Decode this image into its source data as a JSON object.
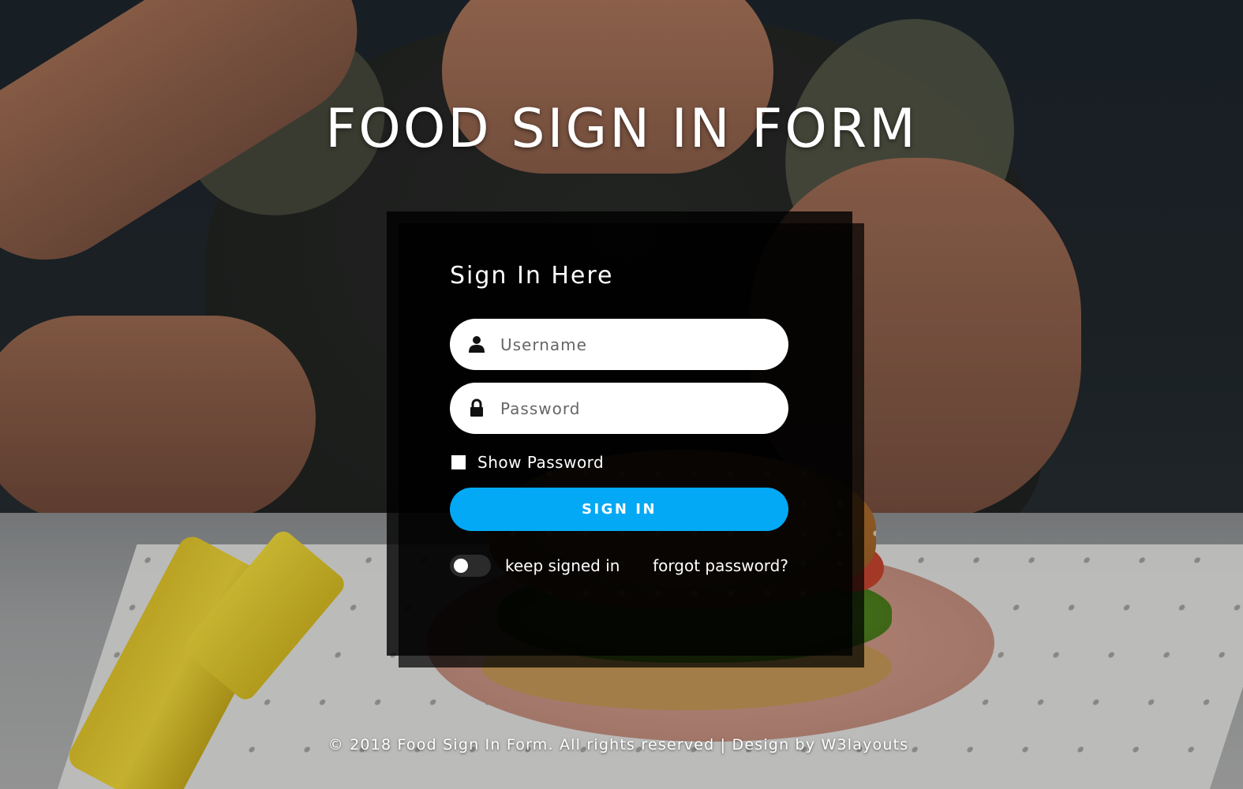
{
  "page": {
    "title": "FOOD SIGN IN FORM"
  },
  "form": {
    "heading": "Sign In Here",
    "username": {
      "placeholder": "Username",
      "value": "",
      "icon": "user-icon"
    },
    "password": {
      "placeholder": "Password",
      "value": "",
      "icon": "lock-icon"
    },
    "show_password_label": "Show Password",
    "show_password_checked": false,
    "submit_label": "SIGN IN",
    "keep_signed_in_label": "keep signed in",
    "keep_signed_in_on": false,
    "forgot_password_label": "forgot password?"
  },
  "footer": {
    "text": "© 2018 Food Sign In Form. All rights reserved | Design by W3layouts"
  },
  "colors": {
    "accent": "#03a9f4",
    "card_background": "#000000",
    "text": "#ffffff"
  }
}
